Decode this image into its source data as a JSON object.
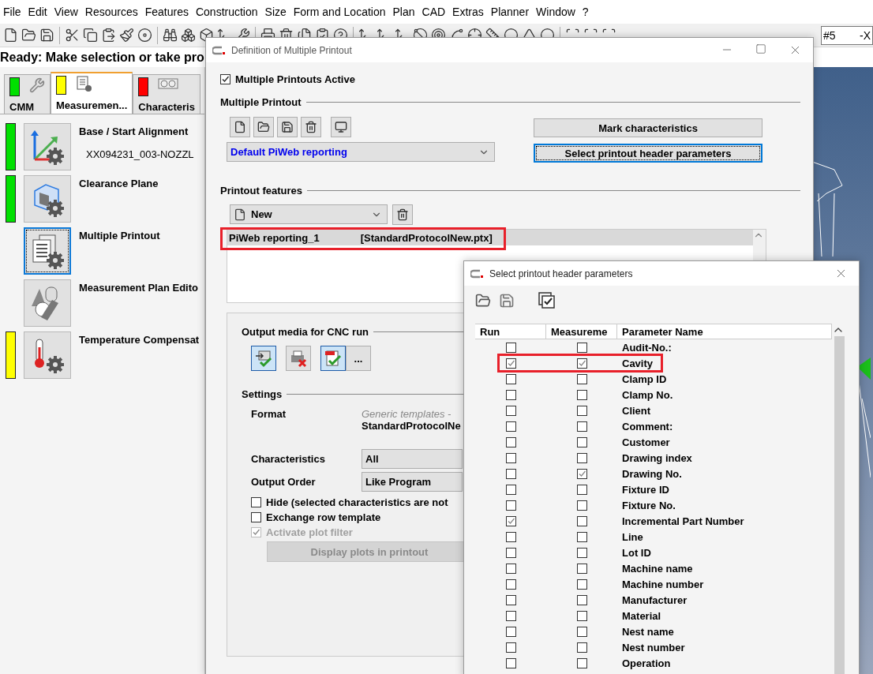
{
  "menu": [
    "File",
    "Edit",
    "View",
    "Resources",
    "Features",
    "Construction",
    "Size",
    "Form and Location",
    "Plan",
    "CAD",
    "Extras",
    "Planner",
    "Window",
    "?"
  ],
  "toolbar": {
    "field_value": "#5",
    "field_suffix": "-X"
  },
  "status_line": "Ready: Make selection or take pro",
  "tabs": [
    {
      "label": "CMM",
      "kind": "wrench",
      "color": "#00e000",
      "selected": false
    },
    {
      "label": "Measuremen...",
      "kind": "document",
      "color": "#ffff00",
      "selected": true
    },
    {
      "label": "Characteris",
      "kind": "symbols",
      "color": "#ff0000",
      "selected": false
    }
  ],
  "plan_items": [
    {
      "label": "Base / Start Alignment",
      "detail": "XX094231_003-NOZZL",
      "kind": "alignment",
      "color": "#00e000",
      "selected": false
    },
    {
      "label": "Clearance Plane",
      "kind": "cube",
      "color": "#00e000",
      "selected": false
    },
    {
      "label": "Multiple Printout",
      "kind": "printout",
      "selected": true
    },
    {
      "label": "Measurement Plan Edito",
      "kind": "shapes",
      "selected": false
    },
    {
      "label": "Temperature Compensat",
      "kind": "thermometer",
      "color": "#ffff00",
      "selected": false
    }
  ],
  "dialog_main": {
    "title": "Definition of Multiple Printout",
    "active_checkbox": {
      "label": "Multiple Printouts Active",
      "checked": true
    },
    "multiple_printout": {
      "heading": "Multiple Printout",
      "template": "Default PiWeb reporting",
      "buttons": [
        {
          "label": "Mark characteristics",
          "focused": false
        },
        {
          "label": "Select printout header parameters",
          "focused": true
        }
      ]
    },
    "printout_features": {
      "heading": "Printout features",
      "new_label": "New",
      "items": [
        {
          "name": "PiWeb reporting_1",
          "file": "[StandardProtocolNew.ptx]",
          "selected": true,
          "highlighted": true
        }
      ]
    },
    "output_media": {
      "heading": "Output media for CNC run",
      "more": "...",
      "buttons": [
        {
          "kind": "export",
          "selected": true
        },
        {
          "kind": "printer",
          "selected": false
        },
        {
          "kind": "pdf",
          "selected": true
        }
      ]
    },
    "settings": {
      "heading": "Settings",
      "format_label": "Format",
      "format_hint": "Generic templates -",
      "format_value": "StandardProtocolNe",
      "fields": [
        {
          "label": "Characteristics",
          "value": "All"
        },
        {
          "label": "Output Order",
          "value": "Like Program"
        }
      ],
      "checkboxes": [
        {
          "label": "Hide (selected characteristics are not",
          "checked": false,
          "disabled": false
        },
        {
          "label": "Exchange row template",
          "checked": false,
          "disabled": false
        },
        {
          "label": "Activate plot filter",
          "checked": true,
          "disabled": true
        }
      ],
      "plots_button": {
        "label": "Display plots in printout",
        "disabled": true
      }
    }
  },
  "dialog_params": {
    "title": "Select printout header parameters",
    "columns": [
      "Run",
      "Measureme",
      "Parameter Name"
    ],
    "rows": [
      {
        "name": "Audit-No.:",
        "run": false,
        "measurement": false,
        "highlighted": false
      },
      {
        "name": "Cavity",
        "run": true,
        "measurement": true,
        "highlighted": true
      },
      {
        "name": "Clamp ID",
        "run": false,
        "measurement": false,
        "highlighted": false
      },
      {
        "name": "Clamp No.",
        "run": false,
        "measurement": false,
        "highlighted": false
      },
      {
        "name": "Client",
        "run": false,
        "measurement": false,
        "highlighted": false
      },
      {
        "name": "Comment:",
        "run": false,
        "measurement": false,
        "highlighted": false
      },
      {
        "name": "Customer",
        "run": false,
        "measurement": false,
        "highlighted": false
      },
      {
        "name": "Drawing index",
        "run": false,
        "measurement": false,
        "highlighted": false
      },
      {
        "name": "Drawing No.",
        "run": false,
        "measurement": true,
        "highlighted": false
      },
      {
        "name": "Fixture ID",
        "run": false,
        "measurement": false,
        "highlighted": false
      },
      {
        "name": "Fixture No.",
        "run": false,
        "measurement": false,
        "highlighted": false
      },
      {
        "name": "Incremental Part Number",
        "run": true,
        "measurement": false,
        "highlighted": false
      },
      {
        "name": "Line",
        "run": false,
        "measurement": false,
        "highlighted": false
      },
      {
        "name": "Lot ID",
        "run": false,
        "measurement": false,
        "highlighted": false
      },
      {
        "name": "Machine name",
        "run": false,
        "measurement": false,
        "highlighted": false
      },
      {
        "name": "Machine number",
        "run": false,
        "measurement": false,
        "highlighted": false
      },
      {
        "name": "Manufacturer",
        "run": false,
        "measurement": false,
        "highlighted": false
      },
      {
        "name": "Material",
        "run": false,
        "measurement": false,
        "highlighted": false
      },
      {
        "name": "Nest name",
        "run": false,
        "measurement": false,
        "highlighted": false
      },
      {
        "name": "Nest number",
        "run": false,
        "measurement": false,
        "highlighted": false
      },
      {
        "name": "Operation",
        "run": false,
        "measurement": false,
        "highlighted": false
      }
    ]
  }
}
